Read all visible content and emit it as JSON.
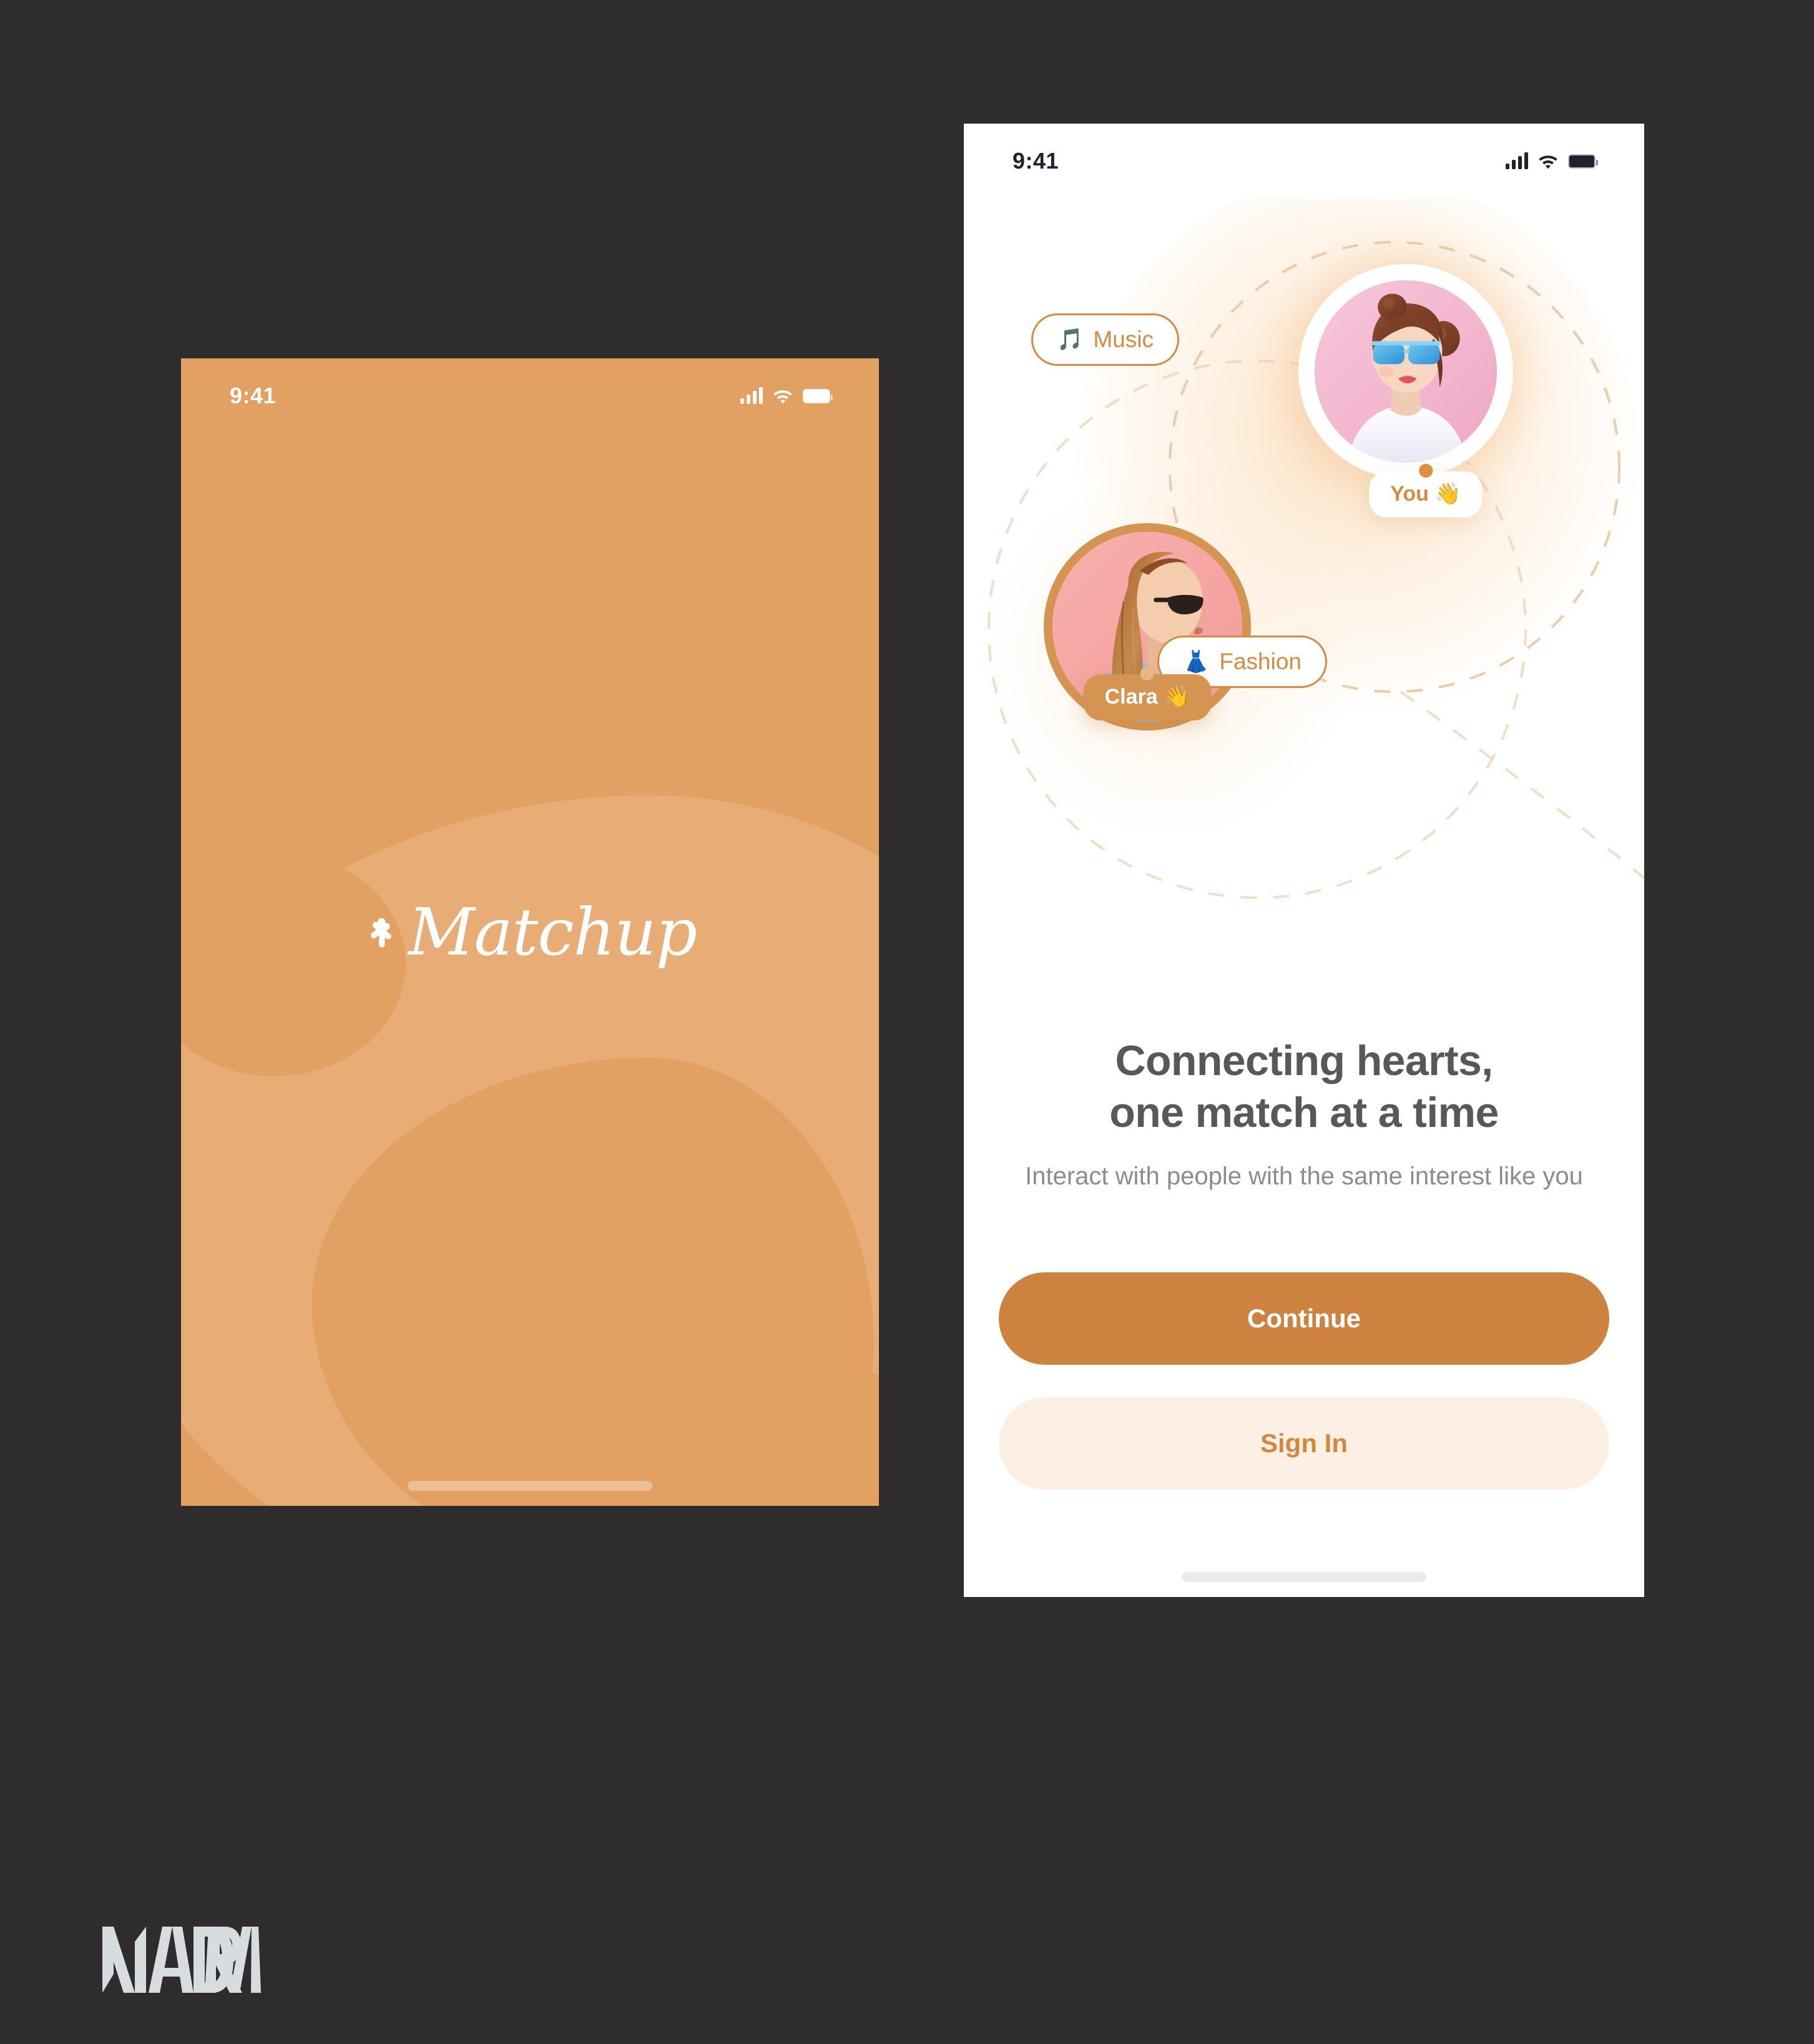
{
  "background_color": "#2e2c2d",
  "brand": {
    "accent": "#d98a3f",
    "accent_deep": "#ce8240",
    "accent_soft": "#fcf0e4",
    "splash_bg": "#e3a063",
    "splash_blob": "#e8ad77"
  },
  "splash_screen": {
    "status_bar": {
      "time": "9:41",
      "signal_icon": "cellular-signal-icon",
      "wifi_icon": "wifi-icon",
      "battery_icon": "battery-icon"
    },
    "logo": {
      "mark_icon": "heart-bird-logo-icon",
      "wordmark": "Matchup"
    },
    "home_indicator": "home-indicator"
  },
  "onboarding_screen": {
    "status_bar": {
      "time": "9:41",
      "signal_icon": "cellular-signal-icon",
      "wifi_icon": "wifi-icon",
      "battery_icon": "battery-icon"
    },
    "hero": {
      "avatars": [
        {
          "id": "you",
          "badge_label": "You 👋",
          "photo_alt": "young-woman-blue-sunglasses-avatar"
        },
        {
          "id": "clara",
          "badge_label": "Clara 👋",
          "photo_alt": "woman-profile-dark-sunglasses-avatar"
        }
      ],
      "chips": [
        {
          "emoji": "🎵",
          "label": "Music",
          "icon": "music-note-icon"
        },
        {
          "emoji": "👗",
          "label": "Fashion",
          "icon": "dress-icon"
        }
      ]
    },
    "copy": {
      "headline_line_1": "Connecting hearts,",
      "headline_line_2": "one match at a time",
      "subhead": "Interact with people with the same interest like you"
    },
    "buttons": {
      "primary": "Continue",
      "secondary": "Sign In"
    },
    "home_indicator": "home-indicator"
  },
  "watermark": {
    "label": "NADRA"
  }
}
